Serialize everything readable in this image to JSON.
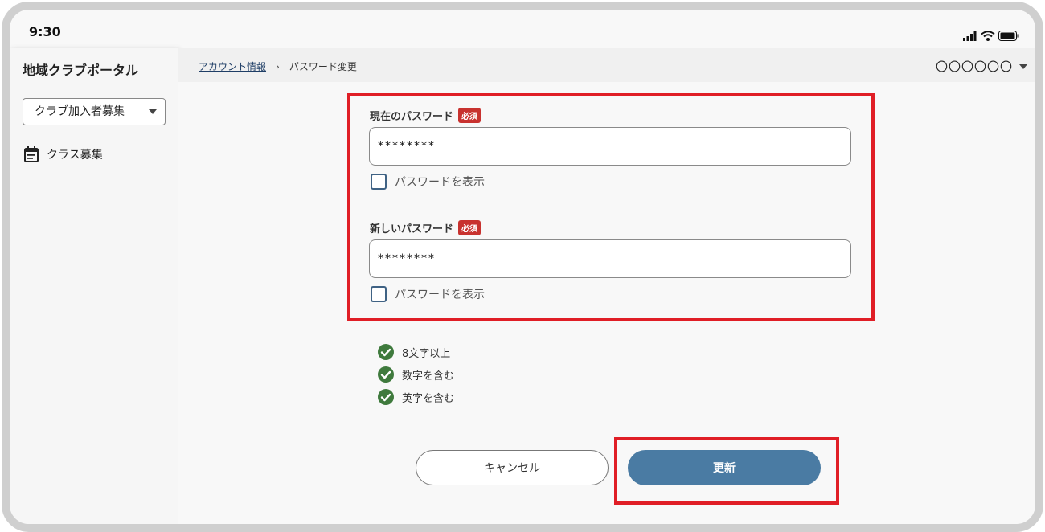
{
  "status_bar": {
    "time": "9:30"
  },
  "sidebar": {
    "app_title": "地域クラブポータル",
    "club_select": {
      "value": "クラブ加入者募集"
    },
    "nav_items": [
      {
        "label": "クラス募集",
        "icon": "calendar-note-icon"
      }
    ]
  },
  "topbar": {
    "breadcrumb": {
      "parent": "アカウント情報",
      "separator": "›",
      "current": "パスワード変更"
    },
    "user_name": "〇〇〇〇〇〇"
  },
  "form": {
    "current_password": {
      "label": "現在のパスワード",
      "required_badge": "必須",
      "value": "********",
      "show_label": "パスワードを表示"
    },
    "new_password": {
      "label": "新しいパスワード",
      "required_badge": "必須",
      "value": "********",
      "show_label": "パスワードを表示"
    },
    "rules": [
      {
        "text": "8文字以上",
        "met": true
      },
      {
        "text": "数字を含む",
        "met": true
      },
      {
        "text": "英字を含む",
        "met": true
      }
    ],
    "cancel_label": "キャンセル",
    "update_label": "更新"
  },
  "colors": {
    "accent": "#4a7ba3",
    "required": "#c8322f",
    "success": "#3f7a3d",
    "highlight": "#e01e26"
  }
}
